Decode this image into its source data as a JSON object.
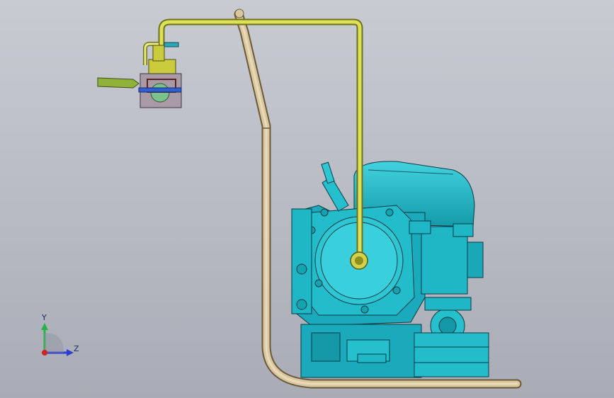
{
  "viewport": {
    "background_top": "#c9cbd3",
    "background_bottom": "#a9acb6"
  },
  "model": {
    "engine_color": "#1fb6c6",
    "engine_edge": "#0b3b44",
    "hose_color": "#cfd24a",
    "frame_color": "#c9b48a",
    "fitting_color": "#8c7b86"
  },
  "triad": {
    "y_label": "Y",
    "z_label": "Z",
    "y_axis_color": "#27b24a",
    "z_axis_color": "#2a3fcf",
    "origin_color": "#d42020"
  }
}
